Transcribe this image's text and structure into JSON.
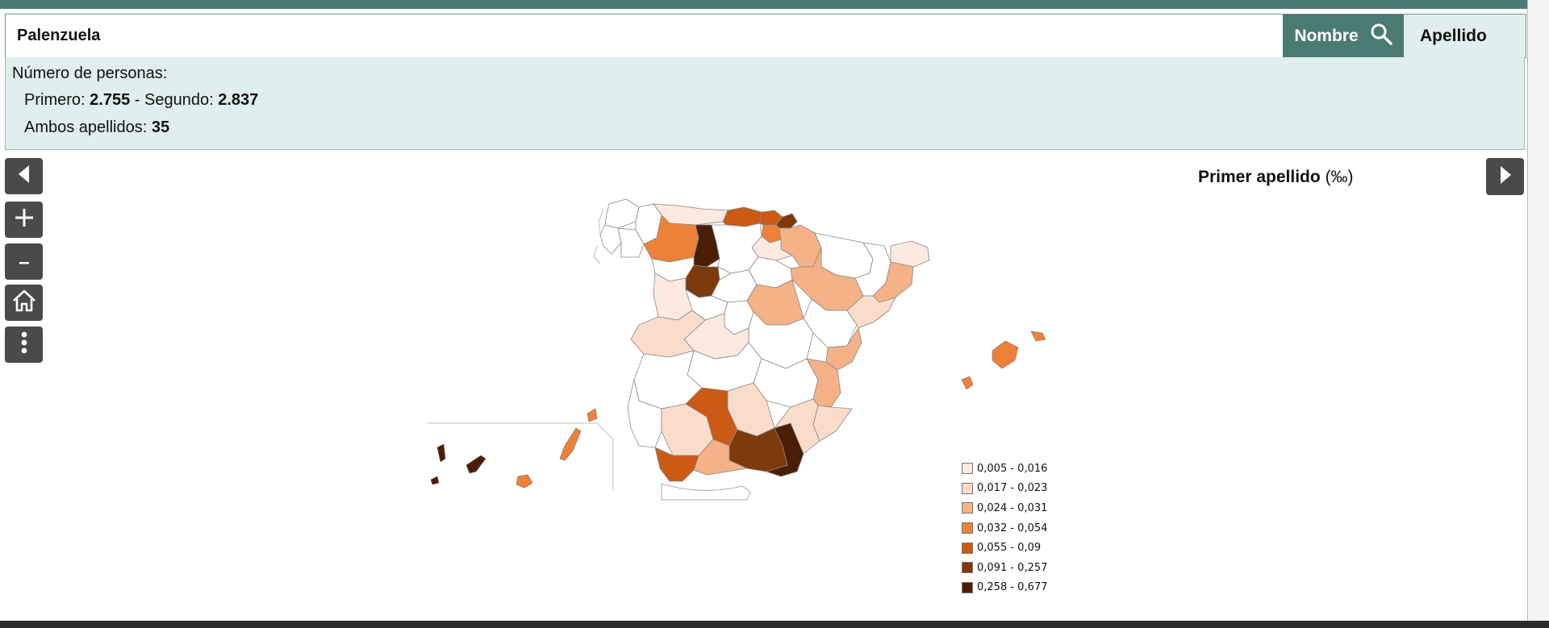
{
  "search": {
    "value": "Palenzuela",
    "nombre_label": "Nombre",
    "apellido_label": "Apellido"
  },
  "info": {
    "title": "Número de personas:",
    "primero_label": "Primero:",
    "primero_value": "2.755",
    "separator": "-",
    "segundo_label": "Segundo:",
    "segundo_value": "2.837",
    "ambos_label": "Ambos apellidos:",
    "ambos_value": "35"
  },
  "map": {
    "title": "Primer apellido",
    "unit": "(‰)"
  },
  "legend": [
    {
      "label": "0,005 - 0,016",
      "color": "#fde9df"
    },
    {
      "label": "0,017 - 0,023",
      "color": "#fbdccb"
    },
    {
      "label": "0,024 - 0,031",
      "color": "#f5b287"
    },
    {
      "label": "0,032 - 0,054",
      "color": "#ee8138"
    },
    {
      "label": "0,055 - 0,09",
      "color": "#cc5a14"
    },
    {
      "label": "0,091 - 0,257",
      "color": "#7d3a0c"
    },
    {
      "label": "0,258 - 0,677",
      "color": "#4a1e05"
    }
  ],
  "controls": {
    "prev_icon": "triangle-left-icon",
    "zoom_in_icon": "plus-icon",
    "zoom_out_icon": "minus-icon",
    "home_icon": "home-icon",
    "menu_icon": "vertical-dots-icon",
    "next_icon": "triangle-right-icon",
    "search_icon": "magnifier-icon"
  },
  "colors": {
    "accent": "#4a7b73",
    "panel": "#e0eeed",
    "control": "#4a4a4a"
  }
}
